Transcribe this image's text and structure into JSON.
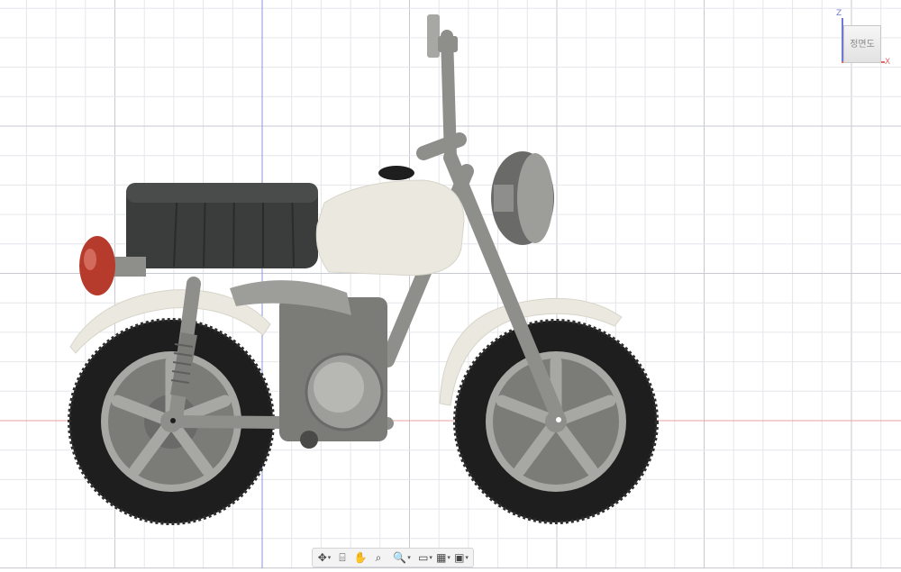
{
  "viewcube": {
    "face_label": "정면도",
    "axis_z": "Z",
    "axis_x": "X"
  },
  "colors": {
    "grid_minor": "#e4e6ea",
    "grid_major": "#c7cad1",
    "axis_vertical": "#8c95d8",
    "axis_horizontal": "#e8a0a0",
    "seat": "#3b3d3c",
    "tank": "#ebe9df",
    "fender": "#ebe9df",
    "frame": "#8e8e8a",
    "tire": "#1e1e1e",
    "rim": "#a7a7a4",
    "tail_light": "#b73b2c"
  },
  "toolbar": {
    "items": [
      {
        "name": "orbit-icon",
        "glyph": "✥",
        "caret": "▾"
      },
      {
        "name": "look-at-icon",
        "glyph": "⌸",
        "caret": ""
      },
      {
        "name": "pan-icon",
        "glyph": "✋",
        "caret": ""
      },
      {
        "name": "zoom-window-icon",
        "glyph": "⌕",
        "caret": ""
      },
      {
        "name": "zoom-icon",
        "glyph": "🔍",
        "caret": "▾"
      },
      {
        "name": "display-settings-icon",
        "glyph": "▭",
        "caret": "▾"
      },
      {
        "name": "grid-settings-icon",
        "glyph": "▦",
        "caret": "▾"
      },
      {
        "name": "viewports-icon",
        "glyph": "▣",
        "caret": "▾"
      }
    ]
  }
}
